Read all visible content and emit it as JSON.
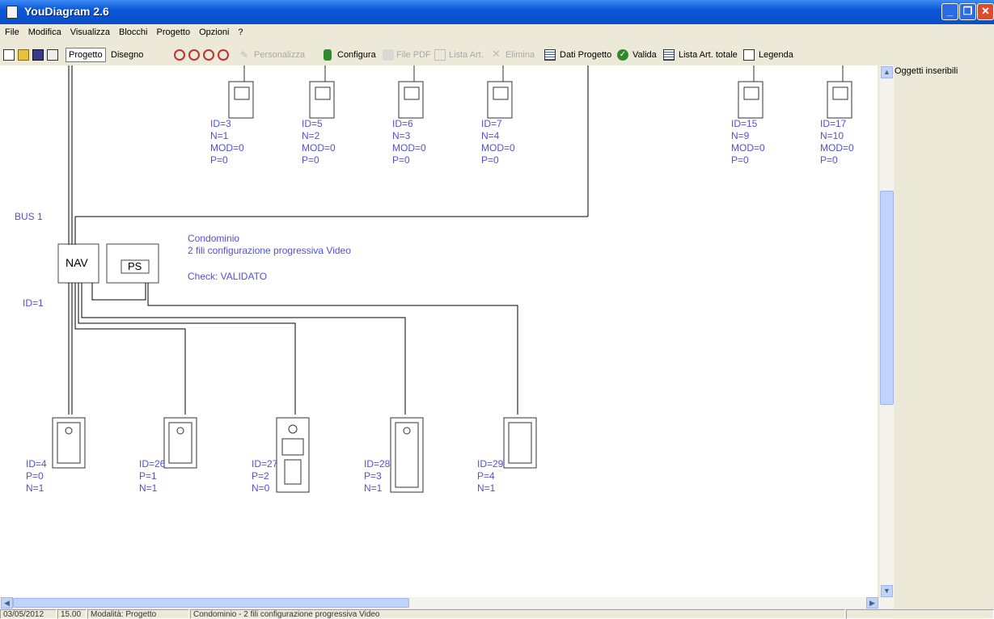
{
  "window": {
    "title": "YouDiagram 2.6"
  },
  "menu": [
    "File",
    "Modifica",
    "Visualizza",
    "Blocchi",
    "Progetto",
    "Opzioni",
    "?"
  ],
  "toolbar": {
    "progetto": "Progetto",
    "disegno": "Disegno",
    "personalizza": "Personalizza",
    "configura": "Configura",
    "file_pdf": "File PDF",
    "lista_art": "Lista Art.",
    "elimina": "Elimina",
    "dati_progetto": "Dati Progetto",
    "valida": "Valida",
    "lista_art_totale": "Lista Art. totale",
    "legenda": "Legenda"
  },
  "side_panel": {
    "title": "Oggetti inseribili"
  },
  "diagram": {
    "bus_label": "BUS 1",
    "nav_label": "NAV",
    "ps_label": "PS",
    "nav_id": "ID=1",
    "info_line1": "Condominio",
    "info_line2": "2 fili configurazione progressiva Video",
    "info_line3": "Check: VALIDATO",
    "monitors": [
      {
        "id": "ID=3",
        "n": "N=1",
        "mod": "MOD=0",
        "p": "P=0"
      },
      {
        "id": "ID=5",
        "n": "N=2",
        "mod": "MOD=0",
        "p": "P=0"
      },
      {
        "id": "ID=6",
        "n": "N=3",
        "mod": "MOD=0",
        "p": "P=0"
      },
      {
        "id": "ID=7",
        "n": "N=4",
        "mod": "MOD=0",
        "p": "P=0"
      },
      {
        "id": "ID=15",
        "n": "N=9",
        "mod": "MOD=0",
        "p": "P=0"
      },
      {
        "id": "ID=17",
        "n": "N=10",
        "mod": "MOD=0",
        "p": "P=0"
      }
    ],
    "panels": [
      {
        "id": "ID=4",
        "p": "P=0",
        "n": "N=1"
      },
      {
        "id": "ID=26",
        "p": "P=1",
        "n": "N=1"
      },
      {
        "id": "ID=27",
        "p": "P=2",
        "n": "N=0"
      },
      {
        "id": "ID=28",
        "p": "P=3",
        "n": "N=1"
      },
      {
        "id": "ID=29",
        "p": "P=4",
        "n": "N=1"
      }
    ]
  },
  "status": {
    "date": "03/05/2012",
    "time": "15.00",
    "mode": "Modalità: Progetto",
    "project": "Condominio - 2 fili configurazione progressiva Video"
  },
  "colors": {
    "label": "#5050D8",
    "titlebar": "#0A58D6"
  }
}
